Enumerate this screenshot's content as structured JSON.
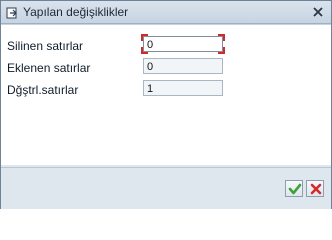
{
  "window": {
    "title": "Yapılan değişiklikler"
  },
  "fields": [
    {
      "label": "Silinen satırlar",
      "value": "0"
    },
    {
      "label": "Eklenen satırlar",
      "value": "0"
    },
    {
      "label": "Dğştrl.satırlar",
      "value": "1"
    }
  ],
  "icons": {
    "title": "dialog-icon",
    "close": "close-icon",
    "ok": "checkmark-icon",
    "cancel": "cancel-x-icon"
  },
  "colors": {
    "ok_green": "#3ea13a",
    "cancel_red": "#d22b2b",
    "focus_corner": "#d12a2a"
  }
}
